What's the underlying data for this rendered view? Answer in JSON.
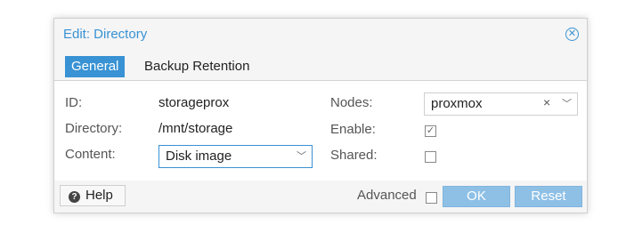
{
  "dialog": {
    "title": "Edit: Directory",
    "close_icon": "close-circle-icon"
  },
  "tabs": [
    {
      "label": "General",
      "active": true
    },
    {
      "label": "Backup Retention",
      "active": false
    }
  ],
  "form": {
    "id_label": "ID:",
    "id_value": "storageprox",
    "directory_label": "Directory:",
    "directory_value": "/mnt/storage",
    "content_label": "Content:",
    "content_value": "Disk image",
    "nodes_label": "Nodes:",
    "nodes_value": "proxmox",
    "enable_label": "Enable:",
    "enable_checked": true,
    "shared_label": "Shared:",
    "shared_checked": false
  },
  "footer": {
    "help_label": "Help",
    "help_icon": "question-circle-icon",
    "advanced_label": "Advanced",
    "advanced_checked": false,
    "ok_label": "OK",
    "reset_label": "Reset"
  },
  "colors": {
    "accent": "#3892d4",
    "disabled_button": "#8ec0e6"
  }
}
